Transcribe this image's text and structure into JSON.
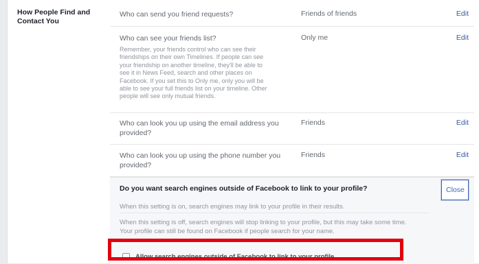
{
  "section_title": "How People Find and Contact You",
  "rows": [
    {
      "question": "Who can send you friend requests?",
      "value": "Friends of friends",
      "edit": "Edit"
    },
    {
      "question": "Who can see your friends list?",
      "value": "Only me",
      "edit": "Edit",
      "description": "Remember, your friends control who can see their friendships on their own Timelines. If people can see your friendship on another timeline, they'll be able to see it in News Feed, search and other places on Facebook. If you set this to Only me, only you will be able to see your full friends list on your timeline. Other people will see only mutual friends."
    },
    {
      "question": "Who can look you up using the email address you provided?",
      "value": "Friends",
      "edit": "Edit"
    },
    {
      "question": "Who can look you up using the phone number you provided?",
      "value": "Friends",
      "edit": "Edit"
    }
  ],
  "expanded": {
    "question": "Do you want search engines outside of Facebook to link to your profile?",
    "close": "Close",
    "paragraph1": "When this setting is on, search engines may link to your profile in their results.",
    "paragraph2": "When this setting is off, search engines will stop linking to your profile, but this may take some time. Your profile can still be found on Facebook if people search for your name.",
    "checkbox_label": "Allow search engines outside of Facebook to link to your profile",
    "checkbox_checked": false
  },
  "colors": {
    "link": "#365899",
    "highlight": "#e0000f",
    "button_border": "#4267b2"
  }
}
